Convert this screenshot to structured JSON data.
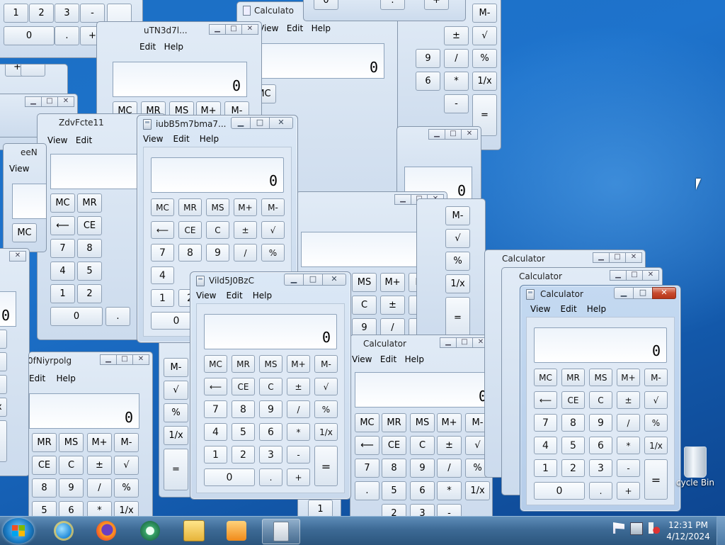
{
  "calculator": {
    "title": "Calculator",
    "menu": [
      "View",
      "Edit",
      "Help"
    ],
    "display": "0",
    "buttons": {
      "mc": "MC",
      "mr": "MR",
      "ms": "MS",
      "mplus": "M+",
      "mminus": "M-",
      "back": "⟵",
      "ce": "CE",
      "c": "C",
      "pm": "±",
      "sqrt": "√",
      "n7": "7",
      "n8": "8",
      "n9": "9",
      "div": "/",
      "pct": "%",
      "n4": "4",
      "n5": "5",
      "n6": "6",
      "mul": "*",
      "inv": "1/x",
      "n1": "1",
      "n2": "2",
      "n3": "3",
      "sub": "-",
      "eq": "=",
      "n0": "0",
      "dot": ".",
      "add": "+"
    }
  },
  "windows": {
    "w_vild": {
      "title": "Vild5J0BzC"
    },
    "w_iubb": {
      "title": "iubB5m7bma7..."
    },
    "w_utn": {
      "title": "uTN3d7l..."
    },
    "w_zdv": {
      "title": "ZdvFcte11"
    },
    "w_een": {
      "title": "eeN"
    },
    "w_0fn": {
      "title": "0fNiyrpolg"
    },
    "w_calc_mid": {
      "title": "Calculator"
    },
    "w_calc_top": {
      "title": "Calculato"
    },
    "w_calc_b1": {
      "title": "Calculator"
    },
    "w_calc_b2": {
      "title": "Calculator"
    }
  },
  "desktop": {
    "recycle_bin_label": "cycle Bin"
  },
  "taskbar": {
    "clock_time": "12:31 PM",
    "clock_date": "4/12/2024",
    "apps": [
      "internet-explorer-icon",
      "firefox-icon",
      "media-icon",
      "file-explorer-icon",
      "media-player-icon",
      "calculator-icon"
    ]
  }
}
